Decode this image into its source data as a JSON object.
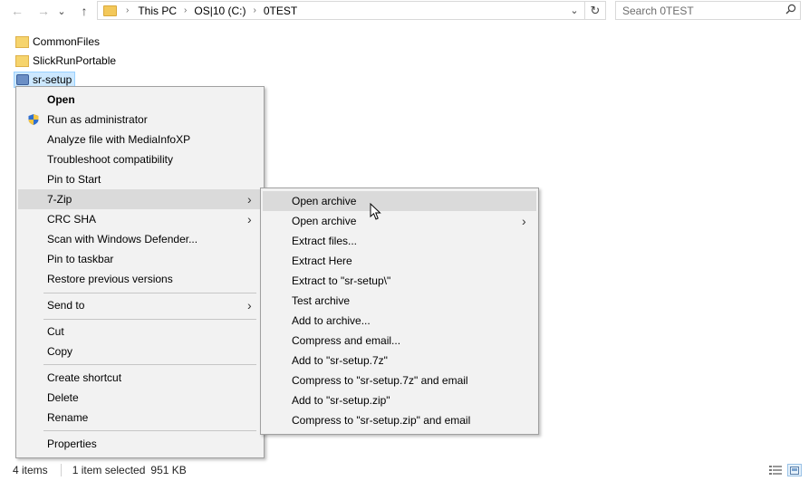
{
  "nav": {
    "back": "←",
    "forward": "→",
    "recent": "⌄",
    "up": "↑"
  },
  "address": {
    "crumbs": [
      "This PC",
      "OS|10 (C:)",
      "0TEST"
    ],
    "separator": "›",
    "dropdown": "⌄",
    "refresh": "↻"
  },
  "search": {
    "placeholder": "Search 0TEST",
    "icon": "search-icon"
  },
  "files": [
    {
      "name": "CommonFiles",
      "icon": "folder-icon"
    },
    {
      "name": "SlickRunPortable",
      "icon": "folder-icon"
    },
    {
      "name": "sr-setup",
      "icon": "exe-icon",
      "selected": true
    }
  ],
  "context_menu": {
    "items": [
      {
        "label": "Open",
        "bold": true
      },
      {
        "label": "Run as administrator",
        "icon": "shield-icon"
      },
      {
        "label": "Analyze file with MediaInfoXP"
      },
      {
        "label": "Troubleshoot compatibility"
      },
      {
        "label": "Pin to Start"
      },
      {
        "label": "7-Zip",
        "submenu": true,
        "highlighted": true
      },
      {
        "label": "CRC SHA",
        "submenu": true
      },
      {
        "label": "Scan with Windows Defender..."
      },
      {
        "label": "Pin to taskbar"
      },
      {
        "label": "Restore previous versions"
      },
      {
        "label": "Send to",
        "submenu": true
      },
      {
        "label": "Cut"
      },
      {
        "label": "Copy"
      },
      {
        "label": "Create shortcut"
      },
      {
        "label": "Delete"
      },
      {
        "label": "Rename"
      },
      {
        "label": "Properties"
      }
    ],
    "arrow": "›"
  },
  "zip_submenu": {
    "items": [
      {
        "label": "Open archive",
        "highlighted": true
      },
      {
        "label": "Open archive",
        "submenu": true
      },
      {
        "label": "Extract files..."
      },
      {
        "label": "Extract Here"
      },
      {
        "label": "Extract to \"sr-setup\\\""
      },
      {
        "label": "Test archive"
      },
      {
        "label": "Add to archive..."
      },
      {
        "label": "Compress and email..."
      },
      {
        "label": "Add to \"sr-setup.7z\""
      },
      {
        "label": "Compress to \"sr-setup.7z\" and email"
      },
      {
        "label": "Add to \"sr-setup.zip\""
      },
      {
        "label": "Compress to \"sr-setup.zip\" and email"
      }
    ]
  },
  "status": {
    "item_count": "4 items",
    "selection": "1 item selected",
    "size": "951 KB"
  },
  "colors": {
    "menu_bg": "#f2f2f2",
    "menu_highlight": "#dadada",
    "selection_bg": "#cce8ff",
    "folder": "#f6d46d"
  }
}
